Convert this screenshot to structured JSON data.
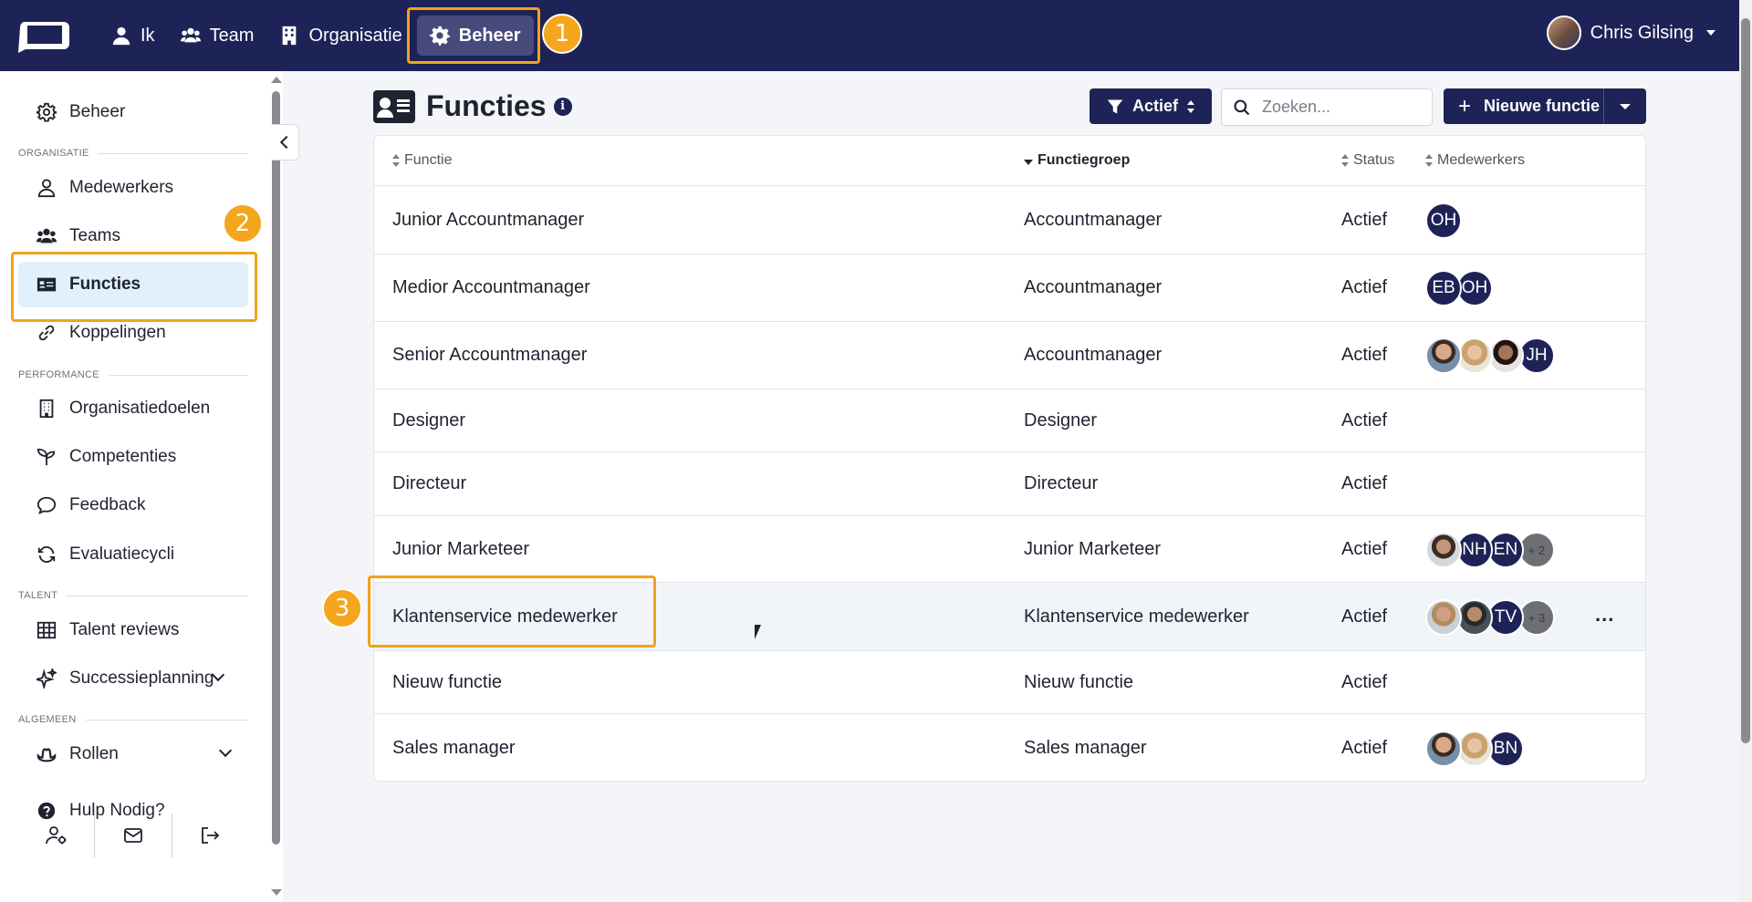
{
  "nav": {
    "items": [
      {
        "label": "Ik",
        "icon": "user-icon"
      },
      {
        "label": "Team",
        "icon": "users-icon"
      },
      {
        "label": "Organisatie",
        "icon": "building-icon"
      },
      {
        "label": "Beheer",
        "icon": "gear-icon",
        "active": true
      }
    ],
    "user_name": "Chris Gilsing"
  },
  "annotations": [
    "1",
    "2",
    "3"
  ],
  "sidebar": {
    "top_item": "Beheer",
    "sections": {
      "organisatie": "ORGANISATIE",
      "performance": "PERFORMANCE",
      "talent": "TALENT",
      "algemeen": "ALGEMEEN"
    },
    "items": {
      "medewerkers": "Medewerkers",
      "teams": "Teams",
      "functies": "Functies",
      "koppelingen": "Koppelingen",
      "organisatiedoelen": "Organisatiedoelen",
      "competenties": "Competenties",
      "feedback": "Feedback",
      "evaluatiecycli": "Evaluatiecycli",
      "talent_reviews": "Talent reviews",
      "successieplanning": "Successieplanning",
      "rollen": "Rollen",
      "hulp": "Hulp Nodig?"
    }
  },
  "page": {
    "title": "Functies",
    "filter_label": "Actief",
    "search_placeholder": "Zoeken...",
    "new_button": "Nieuwe functie"
  },
  "table": {
    "headers": {
      "functie": "Functie",
      "functiegroep": "Functiegroep",
      "status": "Status",
      "medewerkers": "Medewerkers"
    },
    "rows": [
      {
        "functie": "Junior Accountmanager",
        "groep": "Accountmanager",
        "status": "Actief",
        "avatars": [
          {
            "type": "initials",
            "text": "OH"
          }
        ]
      },
      {
        "functie": "Medior Accountmanager",
        "groep": "Accountmanager",
        "status": "Actief",
        "avatars": [
          {
            "type": "initials",
            "text": "EB"
          },
          {
            "type": "initials",
            "text": "OH"
          }
        ]
      },
      {
        "functie": "Senior Accountmanager",
        "groep": "Accountmanager",
        "status": "Actief",
        "avatars": [
          {
            "type": "photo1"
          },
          {
            "type": "photo2"
          },
          {
            "type": "photo3"
          },
          {
            "type": "initials",
            "text": "JH"
          }
        ]
      },
      {
        "functie": "Designer",
        "groep": "Designer",
        "status": "Actief",
        "avatars": []
      },
      {
        "functie": "Directeur",
        "groep": "Directeur",
        "status": "Actief",
        "avatars": []
      },
      {
        "functie": "Junior Marketeer",
        "groep": "Junior Marketeer",
        "status": "Actief",
        "avatars": [
          {
            "type": "photo4"
          },
          {
            "type": "initials",
            "text": "NH"
          },
          {
            "type": "initials",
            "text": "EN"
          },
          {
            "type": "more",
            "text": "+ 2"
          }
        ]
      },
      {
        "functie": "Klantenservice medewerker",
        "groep": "Klantenservice medewerker",
        "status": "Actief",
        "avatars": [
          {
            "type": "photo5"
          },
          {
            "type": "photo6"
          },
          {
            "type": "initials",
            "text": "TV"
          },
          {
            "type": "more",
            "text": "+ 3"
          }
        ],
        "more_actions": "..."
      },
      {
        "functie": "Nieuw functie",
        "groep": "Nieuw functie",
        "status": "Actief",
        "avatars": []
      },
      {
        "functie": "Sales manager",
        "groep": "Sales manager",
        "status": "Actief",
        "avatars": [
          {
            "type": "photo1"
          },
          {
            "type": "photo2"
          },
          {
            "type": "initials",
            "text": "BN"
          }
        ]
      }
    ]
  },
  "colors": {
    "brand": "#1e2357",
    "highlight": "#f0a31c",
    "active_item_bg": "#e1f0fb"
  }
}
